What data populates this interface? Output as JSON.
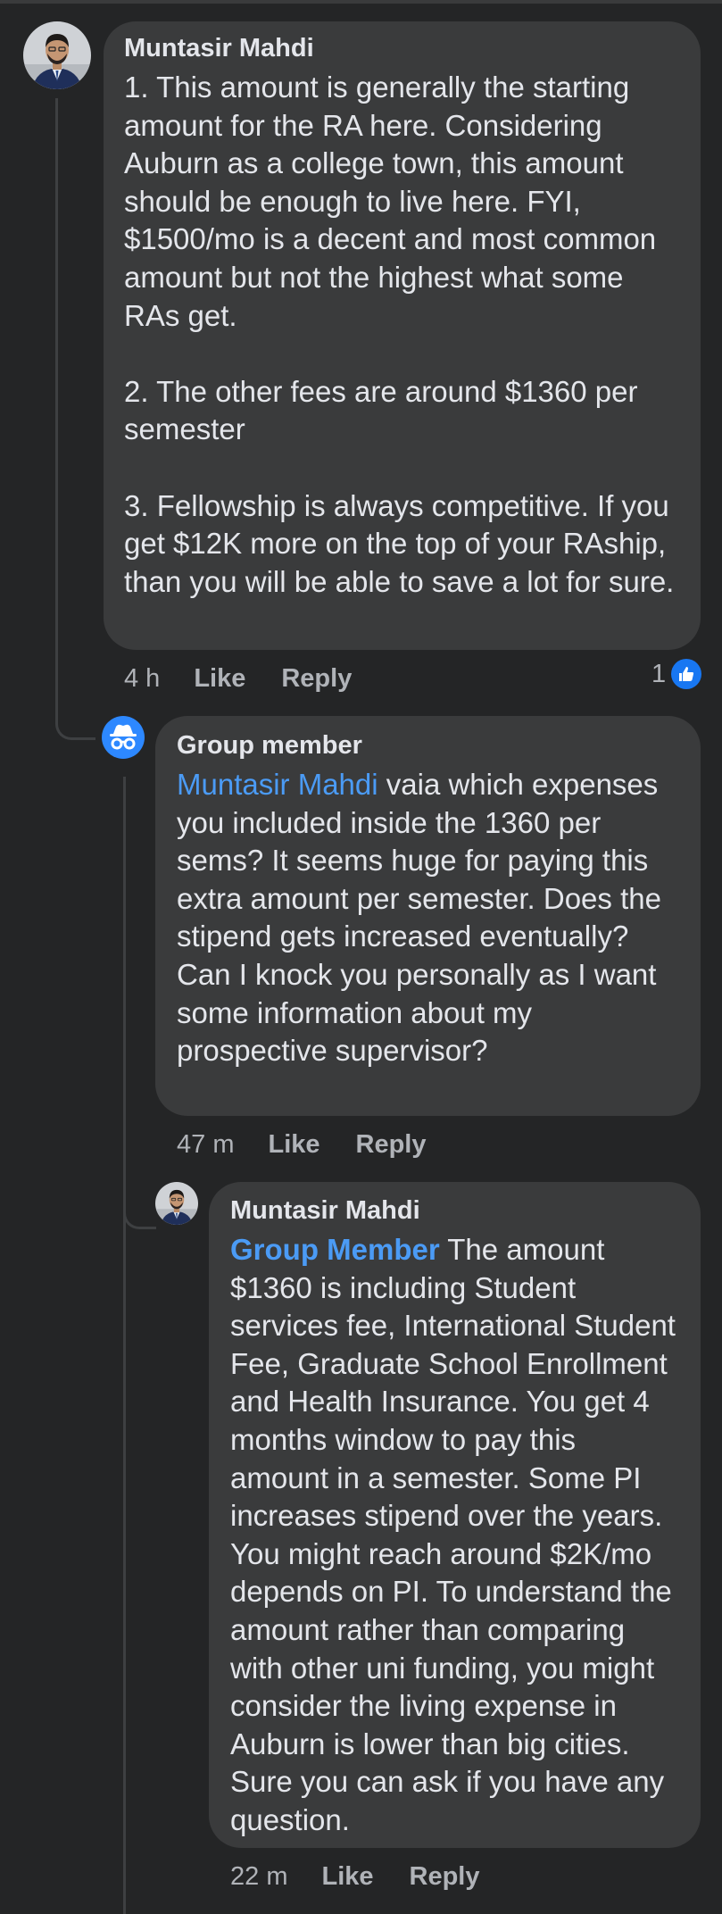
{
  "comments": [
    {
      "author": "Muntasir Mahdi",
      "avatar": "profile-photo",
      "paragraphs": [
        "1. This amount is generally the starting amount for the RA here. Considering Auburn as a college town, this amount should be enough to live here. FYI, $1500/mo is a decent and most common amount but not the highest what some RAs get.",
        "2. The other fees are around $1360 per semester",
        "3. Fellowship is always competitive. If you get $12K more on the top of your RAship, than you will be able to save a lot for sure."
      ],
      "time": "4 h",
      "like_label": "Like",
      "reply_label": "Reply",
      "reaction_count": "1",
      "reaction_icon": "thumbs-up-icon"
    },
    {
      "author": "Group member",
      "avatar": "anonymous-icon",
      "mention": "Muntasir Mahdi",
      "text": " vaia which expenses you included inside the 1360 per sems? It seems huge for paying this extra amount per semester. Does the stipend gets increased eventually? Can I knock you personally as I want some information about my prospective supervisor?",
      "time": "47 m",
      "like_label": "Like",
      "reply_label": "Reply"
    },
    {
      "author": "Muntasir Mahdi",
      "avatar": "profile-photo",
      "mention": "Group Member",
      "text": " The amount $1360 is including Student services fee, International Student Fee, Graduate School Enrollment and Health Insurance. You get 4 months window to pay this amount in a semester. Some PI increases stipend over the years. You might reach around $2K/mo depends on PI. To understand the amount rather than comparing with other uni funding, you might consider the living expense in Auburn is lower than big cities. Sure you can ask if you have any question.",
      "time": "22 m",
      "like_label": "Like",
      "reply_label": "Reply"
    }
  ],
  "colors": {
    "background": "#242526",
    "bubble": "#3a3b3c",
    "mention": "#4b9bf5",
    "secondary_text": "#b0b3b8",
    "like_blue": "#1877f2",
    "anon_blue": "#2d88ff"
  }
}
